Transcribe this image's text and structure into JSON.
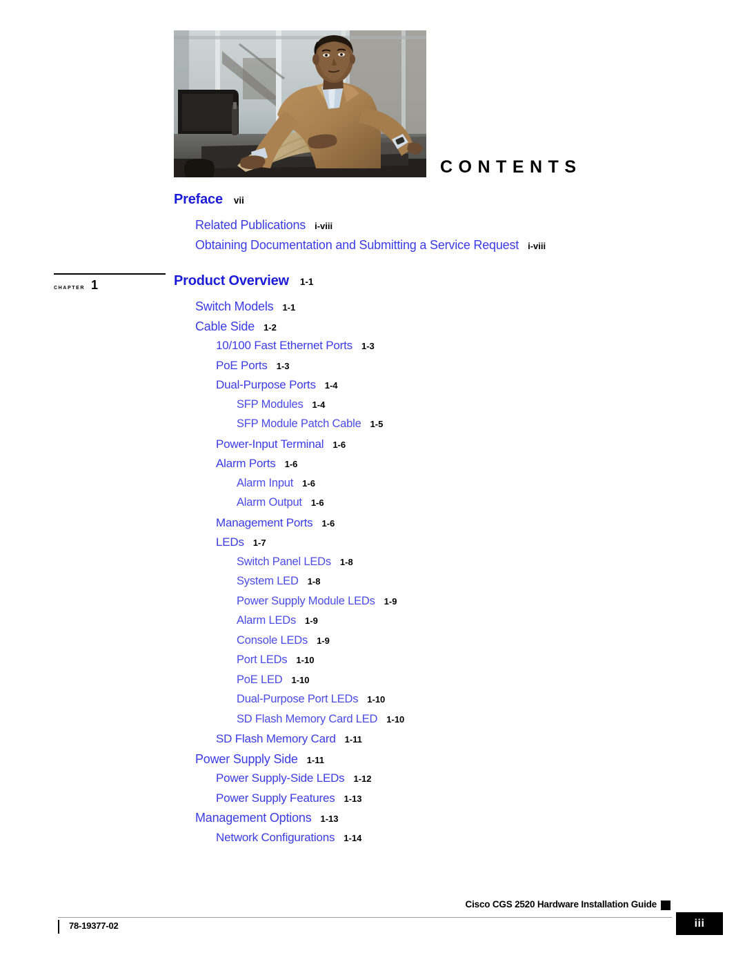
{
  "page": {
    "contents_title": "CONTENTS"
  },
  "hero": {
    "alt": "seated-man-photo"
  },
  "chapter_marker": {
    "word": "CHAPTER",
    "number": "1"
  },
  "toc": {
    "preface": {
      "label": "Preface",
      "page": "vii"
    },
    "preface_entries": [
      {
        "label": "Related Publications",
        "page": "i-viii"
      },
      {
        "label": "Obtaining Documentation and Submitting a Service Request",
        "page": "i-viii"
      }
    ],
    "chapter1": {
      "label": "Product Overview",
      "page": "1-1"
    },
    "chapter1_entries": [
      {
        "label": "Switch Models",
        "page": "1-1",
        "level": 1
      },
      {
        "label": "Cable Side",
        "page": "1-2",
        "level": 1
      },
      {
        "label": "10/100 Fast Ethernet Ports",
        "page": "1-3",
        "level": 2
      },
      {
        "label": "PoE Ports",
        "page": "1-3",
        "level": 2
      },
      {
        "label": "Dual-Purpose Ports",
        "page": "1-4",
        "level": 2
      },
      {
        "label": "SFP Modules",
        "page": "1-4",
        "level": 3
      },
      {
        "label": "SFP Module Patch Cable",
        "page": "1-5",
        "level": 3
      },
      {
        "label": "Power-Input Terminal",
        "page": "1-6",
        "level": 2
      },
      {
        "label": "Alarm Ports",
        "page": "1-6",
        "level": 2
      },
      {
        "label": "Alarm Input",
        "page": "1-6",
        "level": 3
      },
      {
        "label": "Alarm Output",
        "page": "1-6",
        "level": 3
      },
      {
        "label": "Management Ports",
        "page": "1-6",
        "level": 2
      },
      {
        "label": "LEDs",
        "page": "1-7",
        "level": 2
      },
      {
        "label": "Switch Panel LEDs",
        "page": "1-8",
        "level": 3
      },
      {
        "label": "System LED",
        "page": "1-8",
        "level": 3
      },
      {
        "label": "Power Supply Module LEDs",
        "page": "1-9",
        "level": 3
      },
      {
        "label": "Alarm LEDs",
        "page": "1-9",
        "level": 3
      },
      {
        "label": "Console LEDs",
        "page": "1-9",
        "level": 3
      },
      {
        "label": "Port LEDs",
        "page": "1-10",
        "level": 3
      },
      {
        "label": "PoE LED",
        "page": "1-10",
        "level": 3
      },
      {
        "label": "Dual-Purpose Port LEDs",
        "page": "1-10",
        "level": 3
      },
      {
        "label": "SD Flash Memory Card LED",
        "page": "1-10",
        "level": 3
      },
      {
        "label": "SD Flash Memory Card",
        "page": "1-11",
        "level": 2
      },
      {
        "label": "Power Supply Side",
        "page": "1-11",
        "level": 1
      },
      {
        "label": "Power Supply-Side LEDs",
        "page": "1-12",
        "level": 2
      },
      {
        "label": "Power Supply Features",
        "page": "1-13",
        "level": 2
      },
      {
        "label": "Management Options",
        "page": "1-13",
        "level": 1
      },
      {
        "label": "Network Configurations",
        "page": "1-14",
        "level": 2
      }
    ]
  },
  "footer": {
    "guide_title": "Cisco CGS 2520 Hardware Installation Guide",
    "doc_number": "78-19377-02",
    "page_number": "iii"
  },
  "colors": {
    "heading_blue": "#1b1bd9",
    "entry_blue": "#3b3be6",
    "text_black": "#000000"
  }
}
